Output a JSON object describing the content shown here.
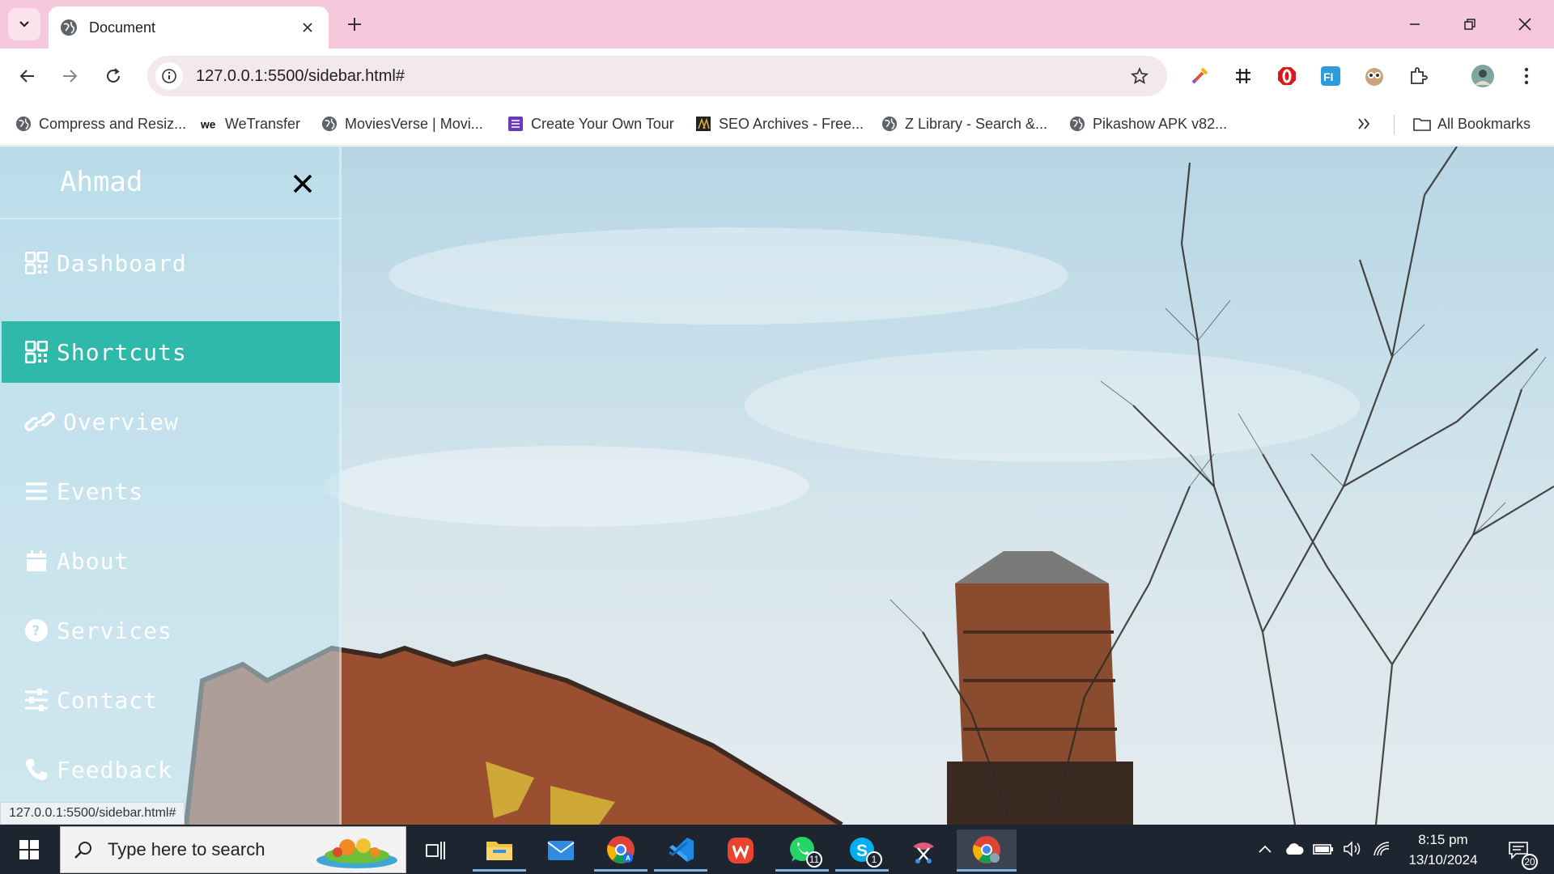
{
  "browser": {
    "tab_title": "Document",
    "url": "127.0.0.1:5500/sidebar.html#",
    "status_url": "127.0.0.1:5500/sidebar.html#",
    "bookmarks": [
      {
        "label": "Compress and Resiz...",
        "icon": "globe-icon"
      },
      {
        "label": "WeTransfer",
        "icon": "wetransfer-icon"
      },
      {
        "label": "MoviesVerse | Movi...",
        "icon": "globe-icon"
      },
      {
        "label": "Create Your Own Tour",
        "icon": "forms-icon"
      },
      {
        "label": "SEO Archives - Free...",
        "icon": "seo-icon"
      },
      {
        "label": "Z Library - Search &...",
        "icon": "globe-icon"
      },
      {
        "label": "Pikashow APK v82...",
        "icon": "globe-icon"
      }
    ],
    "all_bookmarks": "All Bookmarks"
  },
  "sidebar": {
    "brand": "Ahmad",
    "items": [
      {
        "label": "Dashboard",
        "icon": "grid-icon",
        "active": false
      },
      {
        "label": "Shortcuts",
        "icon": "grid-icon",
        "active": true
      },
      {
        "label": "Overview",
        "icon": "link-icon",
        "active": false
      },
      {
        "label": "Events",
        "icon": "list-icon",
        "active": false
      },
      {
        "label": "About",
        "icon": "calendar-icon",
        "active": false
      },
      {
        "label": "Services",
        "icon": "question-icon",
        "active": false
      },
      {
        "label": "Contact",
        "icon": "sliders-icon",
        "active": false
      },
      {
        "label": "Feedback",
        "icon": "phone-icon",
        "active": false
      }
    ],
    "colors": {
      "active_bg": "#2fb9aa",
      "text": "#ffffff"
    }
  },
  "taskbar": {
    "search_placeholder": "Type here to search",
    "time": "8:15 pm",
    "date": "13/10/2024",
    "whatsapp_badge": "11",
    "skype_badge": "1",
    "notifications": "20"
  }
}
